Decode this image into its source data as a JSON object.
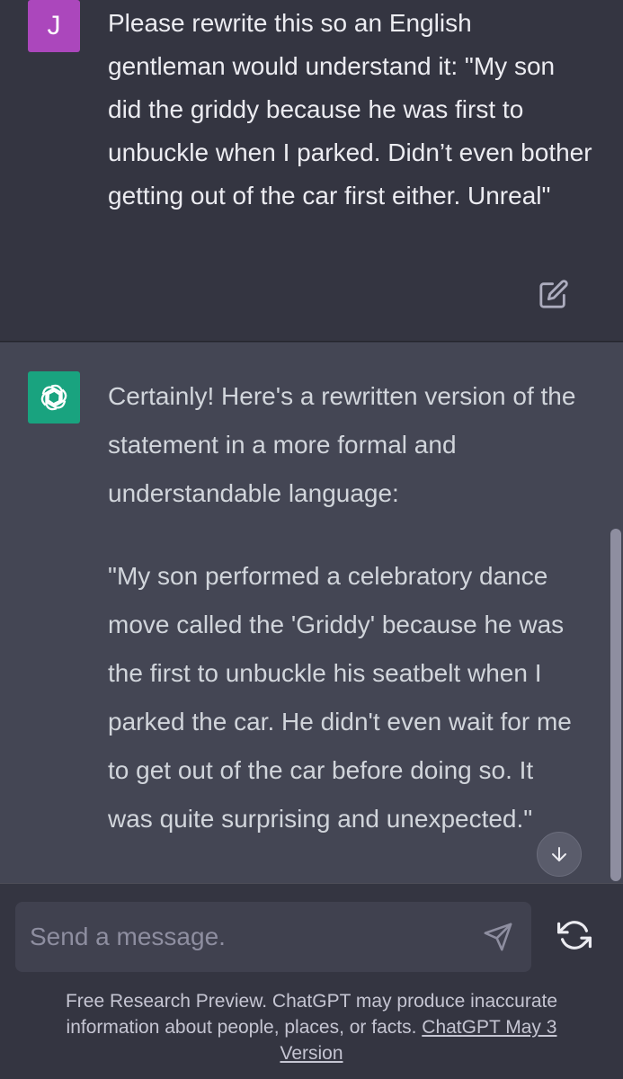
{
  "user_message": {
    "avatar_letter": "J",
    "text": "Please rewrite this so an English gentleman would understand it: \"My son did the griddy because he was first to unbuckle when I parked. Didn’t even bother getting out of the car first either. Unreal\"",
    "edit_icon": "edit-icon"
  },
  "assistant_message": {
    "avatar_icon": "openai-logo-icon",
    "paragraphs": [
      "Certainly! Here's a rewritten version of the statement in a more formal and understandable language:",
      "\"My son performed a celebratory dance move called the 'Griddy' because he was the first to unbuckle his seatbelt when I parked the car. He didn't even wait for me to get out of the car before doing so. It was quite surprising and unexpected.\""
    ]
  },
  "composer": {
    "placeholder": "Send a message.",
    "value": "",
    "send_icon": "send-icon",
    "regenerate_icon": "regenerate-icon"
  },
  "footer": {
    "note": "Free Research Preview. ChatGPT may produce inaccurate information about people, places, or facts.",
    "version_link": "ChatGPT May 3 Version"
  },
  "scroll_down_icon": "arrow-down-icon",
  "colors": {
    "background": "#343541",
    "assistant_background": "#444654",
    "user_avatar": "#ab47bc",
    "assistant_avatar": "#19a37f",
    "input_background": "#40414f"
  }
}
